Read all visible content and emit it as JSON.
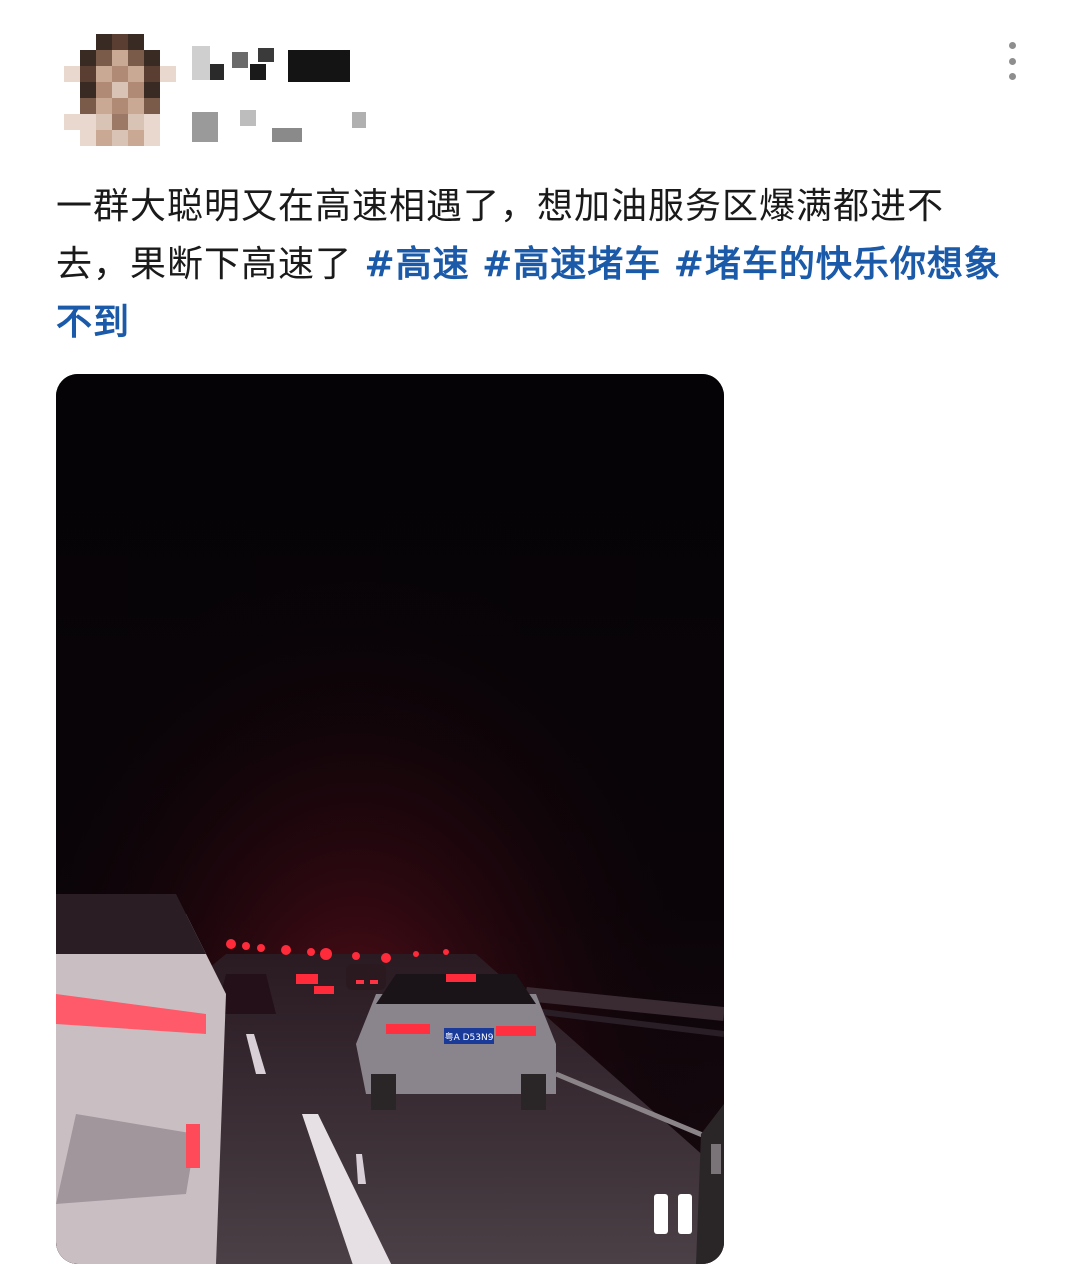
{
  "post": {
    "text": "一群大聪明又在高速相遇了，想加油服务区爆满都进不去，果断下高速了 ",
    "hashtags": [
      "#高速",
      "#高速堵车",
      "#堵车的快乐你想象不到"
    ]
  },
  "author": {
    "avatar": "blurred-avatar",
    "name": "",
    "meta": ""
  },
  "video": {
    "state": "playing",
    "plate_text": "粤A D53N9",
    "controls": {
      "pause_icon": "pause-icon"
    }
  },
  "colors": {
    "text": "#1a1a1a",
    "hashtag": "#1b5aa8",
    "more_dots": "#8e8e8e",
    "video_bg": "#040205"
  },
  "icons": {
    "more": "more-vertical-icon",
    "pause": "pause-icon"
  }
}
